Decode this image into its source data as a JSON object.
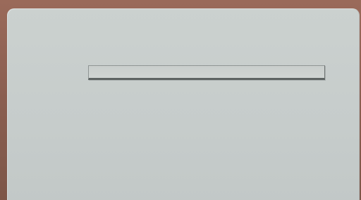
{
  "dialog": {
    "field": {
      "value": "",
      "placeholder": ""
    }
  },
  "colors": {
    "background": "#8a5e50",
    "panel": "#c6cccb",
    "field": "#cdd2d0",
    "field_border": "#5e6463"
  }
}
